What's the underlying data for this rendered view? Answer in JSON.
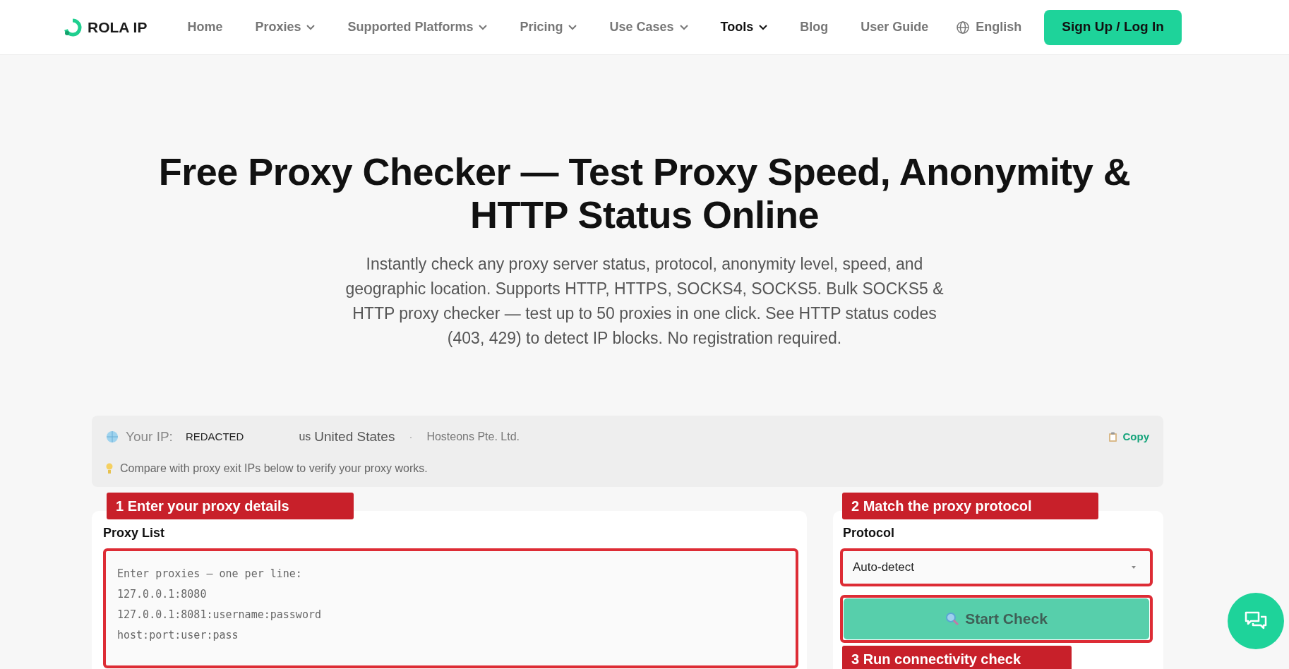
{
  "nav": {
    "logo": "ROLA IP",
    "items": [
      {
        "label": "Home",
        "has_menu": false,
        "selected": false
      },
      {
        "label": "Proxies",
        "has_menu": true,
        "selected": false
      },
      {
        "label": "Supported Platforms",
        "has_menu": true,
        "selected": false
      },
      {
        "label": "Pricing",
        "has_menu": true,
        "selected": false
      },
      {
        "label": "Use Cases",
        "has_menu": true,
        "selected": false
      },
      {
        "label": "Tools",
        "has_menu": true,
        "selected": true
      },
      {
        "label": "Blog",
        "has_menu": false,
        "selected": false
      },
      {
        "label": "User Guide",
        "has_menu": false,
        "selected": false
      }
    ],
    "language": "English",
    "cta": "Sign Up / Log In"
  },
  "hero": {
    "title": "Free Proxy Checker — Test Proxy Speed, Anonymity & HTTP Status Online",
    "subtitle": "Instantly check any proxy server status, protocol, anonymity level, speed, and geographic location. Supports HTTP, HTTPS, SOCKS4, SOCKS5. Bulk SOCKS5 & HTTP proxy checker — test up to 50 proxies in one click. See HTTP status codes (403, 429) to detect IP blocks. No registration required."
  },
  "ip_bar": {
    "label": "Your IP:",
    "ip": "REDACTED",
    "country_code": "us",
    "country": "United States",
    "separator": "·",
    "isp": "Hosteons Pte. Ltd.",
    "copy": "Copy",
    "hint": "Compare with proxy exit IPs below to verify your proxy works."
  },
  "steps": [
    "1 Enter your proxy details",
    "2 Match the proxy protocol",
    "3 Run connectivity check"
  ],
  "proxy_list": {
    "label": "Proxy List",
    "placeholder": "Enter proxies — one per line:\n127.0.0.1:8080\n127.0.0.1:8081:username:password\nhost:port:user:pass"
  },
  "protocol": {
    "label": "Protocol",
    "value": "Auto-detect"
  },
  "start_button": "Start Check"
}
